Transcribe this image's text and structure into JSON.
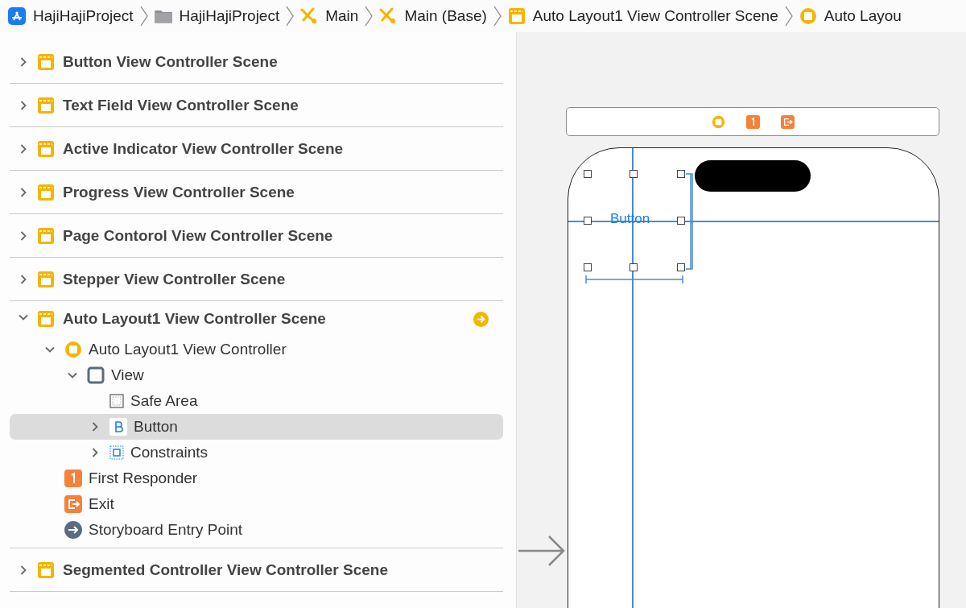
{
  "breadcrumb": [
    {
      "kind": "app",
      "label": "HajiHajiProject"
    },
    {
      "kind": "folder",
      "label": "HajiHajiProject"
    },
    {
      "kind": "storyboard",
      "label": "Main"
    },
    {
      "kind": "storyboard",
      "label": "Main (Base)"
    },
    {
      "kind": "scene",
      "label": "Auto Layout1 View Controller Scene"
    },
    {
      "kind": "controller",
      "label": "Auto Layou"
    }
  ],
  "outline": [
    {
      "kind": "scene",
      "label": "Button View Controller Scene",
      "expanded": false,
      "initial": false
    },
    {
      "kind": "scene",
      "label": "Text Field View Controller Scene",
      "expanded": false,
      "initial": false
    },
    {
      "kind": "scene",
      "label": "Active Indicator View Controller Scene",
      "expanded": false,
      "initial": false
    },
    {
      "kind": "scene",
      "label": "Progress View Controller Scene",
      "expanded": false,
      "initial": false
    },
    {
      "kind": "scene",
      "label": "Page Contorol View Controller Scene",
      "expanded": false,
      "initial": false
    },
    {
      "kind": "scene",
      "label": "Stepper View Controller Scene",
      "expanded": false,
      "initial": false
    },
    {
      "kind": "scene",
      "label": "Auto Layout1 View Controller Scene",
      "expanded": true,
      "initial": true,
      "children": [
        {
          "kind": "controller",
          "label": "Auto Layout1 View Controller",
          "expanded": true,
          "selected": false,
          "children": [
            {
              "kind": "view",
              "label": "View",
              "expanded": true,
              "selected": false,
              "children": [
                {
                  "kind": "safe-area",
                  "label": "Safe Area",
                  "selected": false
                },
                {
                  "kind": "button",
                  "label": "Button",
                  "expanded": false,
                  "selected": true
                },
                {
                  "kind": "constraints",
                  "label": "Constraints",
                  "expanded": false,
                  "selected": false
                }
              ]
            }
          ]
        },
        {
          "kind": "responder",
          "label": "First Responder",
          "selected": false
        },
        {
          "kind": "exit",
          "label": "Exit",
          "selected": false
        },
        {
          "kind": "entry",
          "label": "Storyboard Entry Point",
          "selected": false
        }
      ]
    },
    {
      "kind": "scene",
      "label": "Segmented Controller View Controller Scene",
      "expanded": false,
      "initial": false
    }
  ],
  "canvas": {
    "scene_dock": [
      {
        "kind": "controller"
      },
      {
        "kind": "responder"
      },
      {
        "kind": "exit"
      }
    ],
    "button_title": "Button"
  }
}
